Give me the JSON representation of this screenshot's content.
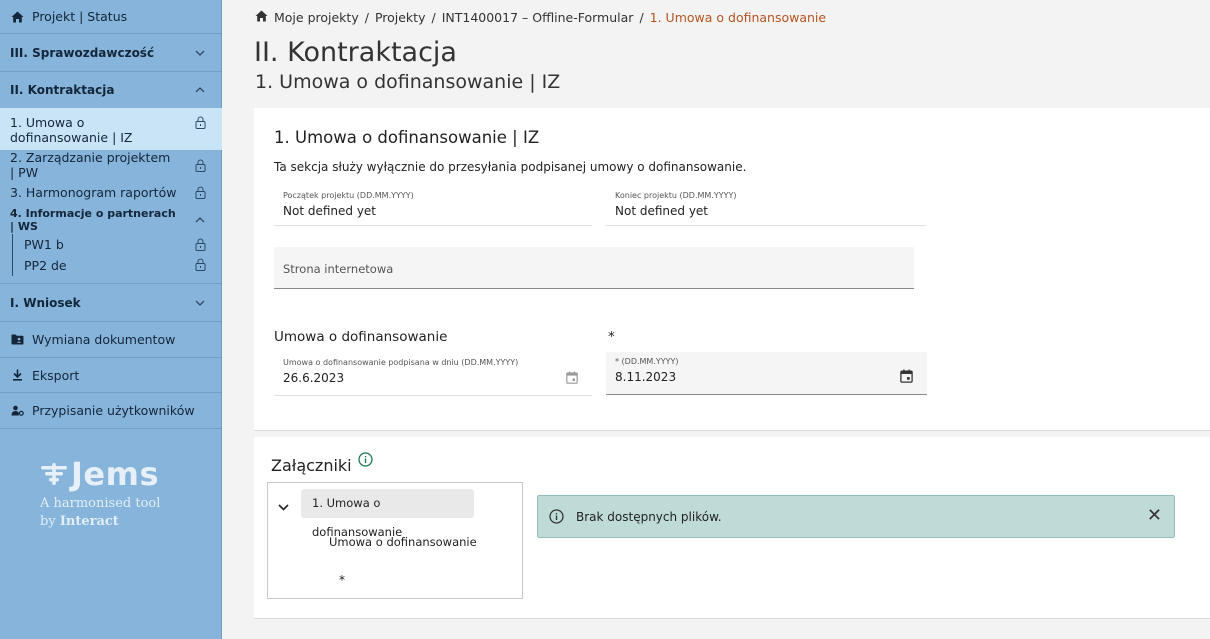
{
  "sidebar": {
    "project_status": "Projekt | Status",
    "sprawozdawczosc": "III. Sprawozdawczość",
    "kontraktacja": "II. Kontraktacja",
    "items": [
      {
        "label": "1. Umowa o dofinansowanie | IZ"
      },
      {
        "label": "2. Zarządzanie projektem | PW"
      },
      {
        "label": "3. Harmonogram raportów"
      },
      {
        "label": "4. Informacje o partnerach | WS"
      }
    ],
    "partners": [
      {
        "label": "PW1 b"
      },
      {
        "label": "PP2 de"
      }
    ],
    "wniosek": "I. Wniosek",
    "wymiana": "Wymiana dokumentow",
    "eksport": "Eksport",
    "przypisanie": "Przypisanie użytkowników",
    "logo_name": "Jems",
    "logo_tag_1": "A harmonised tool",
    "logo_tag_2_prefix": "by ",
    "logo_tag_2_bold": "Interact"
  },
  "breadcrumb": {
    "items": [
      "Moje projekty",
      "Projekty",
      "INT1400017 – Offline-Formular"
    ],
    "separator": "/",
    "current": "1. Umowa o dofinansowanie"
  },
  "page": {
    "title": "II. Kontraktacja",
    "subtitle": "1. Umowa o dofinansowanie | IZ"
  },
  "contract": {
    "title": "1. Umowa o dofinansowanie | IZ",
    "description": "Ta sekcja służy wyłącznie do przesyłania podpisanej umowy o dofinansowanie.",
    "start_label": "Początek projektu (DD.MM.YYYY)",
    "start_value": "Not defined yet",
    "end_label": "Koniec projektu (DD.MM.YYYY)",
    "end_value": "Not defined yet",
    "website_placeholder": "Strona internetowa",
    "agreement_label": "Umowa o dofinansowanie",
    "asterisk_label": "*",
    "signed_label": "Umowa o dofinansowanie podpisana w dniu (DD.MM.YYYY)",
    "signed_value": "26.6.2023",
    "date2_label": "* (DD.MM.YYYY)",
    "date2_value": "8.11.2023"
  },
  "attachments": {
    "title": "Załączniki",
    "tree_node": "1. Umowa o dofinansowanie",
    "tree_child": "Umowa o dofinansowanie",
    "tree_star": "*",
    "alert_text": "Brak dostępnych plików.",
    "close_symbol": "✕"
  },
  "colors": {
    "sidebar_bg": "#86b4da",
    "active_item": "#c9e4f7",
    "breadcrumb_current": "#b4541f",
    "alert_bg": "#bfdbd8"
  }
}
